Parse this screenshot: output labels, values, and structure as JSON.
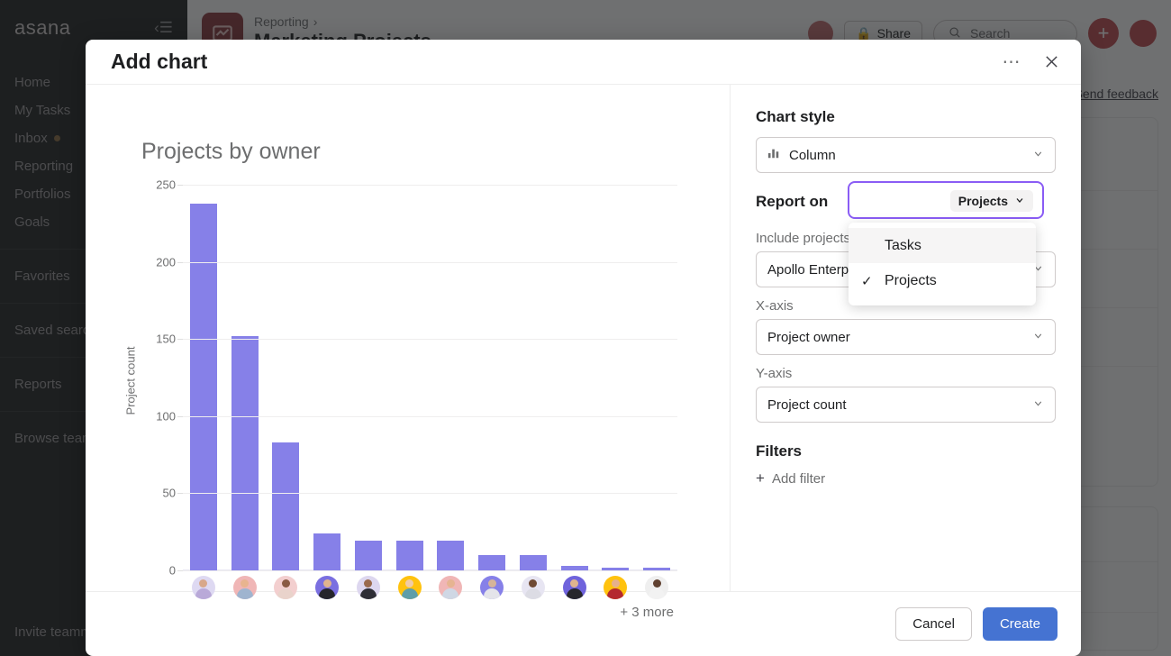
{
  "background": {
    "logo": "asana",
    "nav_primary": [
      "Home",
      "My Tasks",
      "Inbox",
      "Reporting",
      "Portfolios",
      "Goals"
    ],
    "nav_secondary": [
      "Favorites",
      "Saved searches",
      "Reports",
      "Browse teams"
    ],
    "invite": "Invite teammates",
    "breadcrumb_parent": "Reporting",
    "breadcrumb_title": "Marketing Projects",
    "share_label": "Share",
    "search_placeholder": "Search",
    "plus_label": "+",
    "feedback_link": "Send feedback"
  },
  "modal": {
    "title": "Add chart",
    "more_icon": "more-horizontal-icon",
    "close_icon": "close-icon",
    "cancel_label": "Cancel",
    "create_label": "Create"
  },
  "panel": {
    "chart_style": {
      "heading": "Chart style",
      "value": "Column",
      "icon": "column-chart-icon"
    },
    "report_on": {
      "heading": "Report on",
      "value": "Projects",
      "options": [
        {
          "label": "Tasks",
          "selected": false
        },
        {
          "label": "Projects",
          "selected": true
        }
      ],
      "check_glyph": "✓",
      "caret_glyph": "∨"
    },
    "include_projects": {
      "label": "Include projects from",
      "value": "Apollo Enterprises"
    },
    "x_axis": {
      "label": "X-axis",
      "value": "Project owner"
    },
    "y_axis": {
      "label": "Y-axis",
      "value": "Project count"
    },
    "filters": {
      "heading": "Filters",
      "add_label": "Add filter"
    }
  },
  "colors": {
    "bar": "#8680e8",
    "accent_purple": "#8a5cf5",
    "create_blue": "#4573d2"
  },
  "chart_data": {
    "type": "bar",
    "title": "Projects by owner",
    "xlabel": "",
    "ylabel": "Project count",
    "ylim": [
      0,
      250
    ],
    "yticks": [
      0,
      50,
      100,
      150,
      200,
      250
    ],
    "grid": true,
    "legend": false,
    "categories": [
      "owner-1",
      "owner-2",
      "owner-3",
      "owner-4",
      "owner-5",
      "owner-6",
      "owner-7",
      "owner-8",
      "owner-9",
      "owner-10",
      "owner-11",
      "owner-12"
    ],
    "category_type": "avatar",
    "values": [
      238,
      152,
      83,
      24,
      19,
      19,
      19,
      10,
      10,
      3,
      2,
      2
    ],
    "overflow_label": "+ 3 more",
    "avatar_colors": [
      {
        "ring": "#ded9f2",
        "skin": "#d8a88a",
        "shirt": "#b9a9d8"
      },
      {
        "ring": "#f0b6b6",
        "skin": "#e8b48f",
        "shirt": "#9fb4cf"
      },
      {
        "ring": "#f3cfcf",
        "skin": "#8a5a42",
        "shirt": "#e9d3cb"
      },
      {
        "ring": "#7a6fe0",
        "skin": "#e0b48e",
        "shirt": "#26262c"
      },
      {
        "ring": "#ddd7ef",
        "skin": "#9a6a4c",
        "shirt": "#2e2e36"
      },
      {
        "ring": "#ffc20e",
        "skin": "#f0cba6",
        "shirt": "#5f9ea8"
      },
      {
        "ring": "#f0b6b6",
        "skin": "#e6b491",
        "shirt": "#cfd7e4"
      },
      {
        "ring": "#8680e8",
        "skin": "#d6b49a",
        "shirt": "#e4e4ea"
      },
      {
        "ring": "#e7e5f2",
        "skin": "#6f4a34",
        "shirt": "#dcdce4"
      },
      {
        "ring": "#6f63dc",
        "skin": "#e0b48e",
        "shirt": "#26262c"
      },
      {
        "ring": "#ffc20e",
        "skin": "#e6b08c",
        "shirt": "#b4292f"
      },
      {
        "ring": "#efefef",
        "skin": "#5f4030",
        "shirt": "#f2f2f2"
      }
    ]
  }
}
